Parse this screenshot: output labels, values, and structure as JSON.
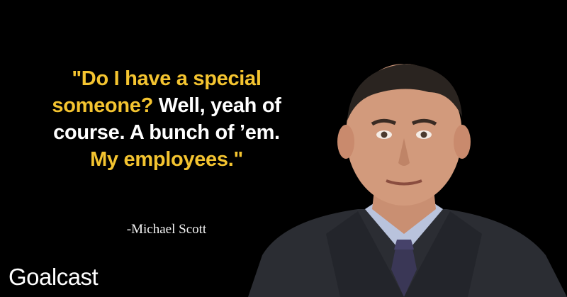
{
  "quote": {
    "line1": "\"Do I have a special",
    "line2_highlight": "someone?",
    "line2_rest": " Well, yeah of",
    "line3": "course. A bunch of ’em.",
    "line4": "My employees.\""
  },
  "author": "-Michael Scott",
  "brand": "Goalcast",
  "colors": {
    "background": "#000000",
    "accent": "#f4c430",
    "text": "#ffffff"
  }
}
